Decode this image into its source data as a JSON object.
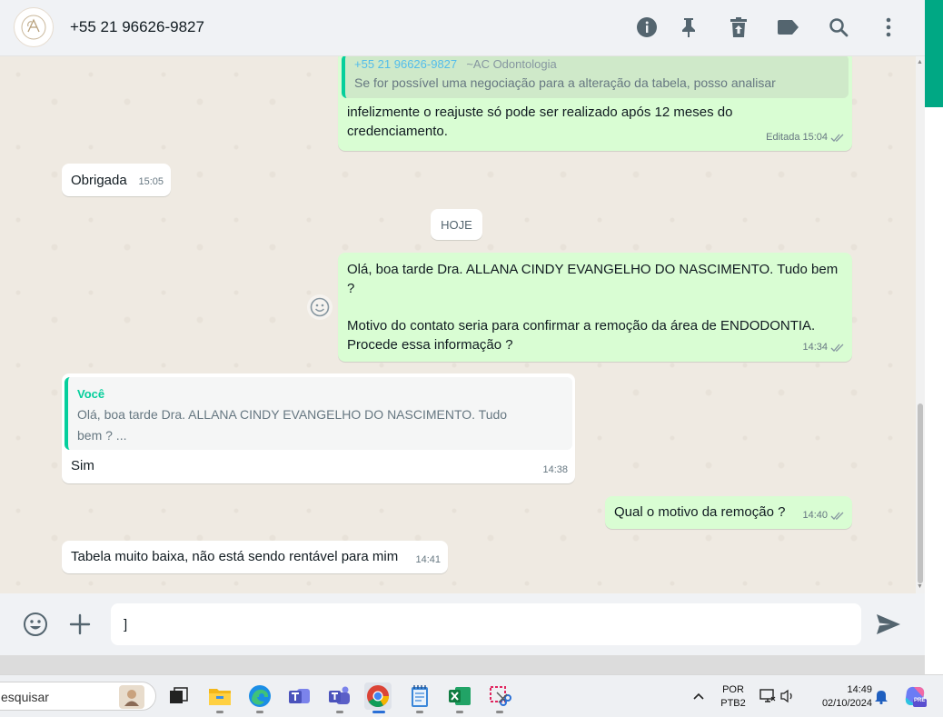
{
  "header": {
    "contact_name": "+55 21 96626-9827",
    "avatar_initials": "CA",
    "icons": [
      "info-icon",
      "pin-icon",
      "delete-icon",
      "label-icon",
      "search-icon",
      "menu-icon"
    ]
  },
  "messages": {
    "m1": {
      "quote_author": "+55 21 96626-9827",
      "quote_author_suffix": "~AC Odontologia",
      "quote_text": "Se for possível uma negociação para a alteração da tabela, posso analisar",
      "text_line1": "infelizmente o reajuste só pode ser realizado após 12 meses do",
      "text_line2": "credenciamento.",
      "edited_label": "Editada",
      "time": "15:04"
    },
    "m2": {
      "text": "Obrigada",
      "time": "15:05"
    },
    "date_separator": "HOJE",
    "m3": {
      "line1": "Olá, boa tarde Dra. ALLANA CINDY EVANGELHO DO NASCIMENTO. Tudo bem",
      "line2": "?",
      "line3": "Motivo do contato seria para confirmar a remoção da área de  ENDODONTIA.",
      "line4": "Procede essa informação ?",
      "time": "14:34"
    },
    "m4": {
      "quote_author": "Você",
      "quote_line1": "Olá, boa tarde Dra. ALLANA CINDY EVANGELHO DO NASCIMENTO. Tudo",
      "quote_line2": "bem ? ...",
      "text": "Sim",
      "time": "14:38"
    },
    "m5": {
      "text": "Qual o motivo da remoção ?",
      "time": "14:40"
    },
    "m6": {
      "text": "Tabela muito baixa, não está sendo rentável para mim",
      "time": "14:41"
    }
  },
  "composer": {
    "input_value": "]",
    "icons": [
      "emoji-icon",
      "plus-icon",
      "send-icon"
    ]
  },
  "taskbar": {
    "search_text": "esquisar",
    "apps": [
      "task-view",
      "file-explorer",
      "edge",
      "teams-classic",
      "teams",
      "chrome",
      "notepad",
      "excel",
      "snipping-tool"
    ],
    "lang_line1": "POR",
    "lang_line2": "PTB2",
    "clock_time": "14:49",
    "clock_date": "02/10/2024",
    "copilot_badge": "PRE"
  },
  "colors": {
    "outgoing_bubble": "#d9fdd3",
    "incoming_bubble": "#ffffff",
    "accent": "#00a884",
    "quote_bar": "#06cf9c",
    "chat_bg": "#efeae2"
  }
}
